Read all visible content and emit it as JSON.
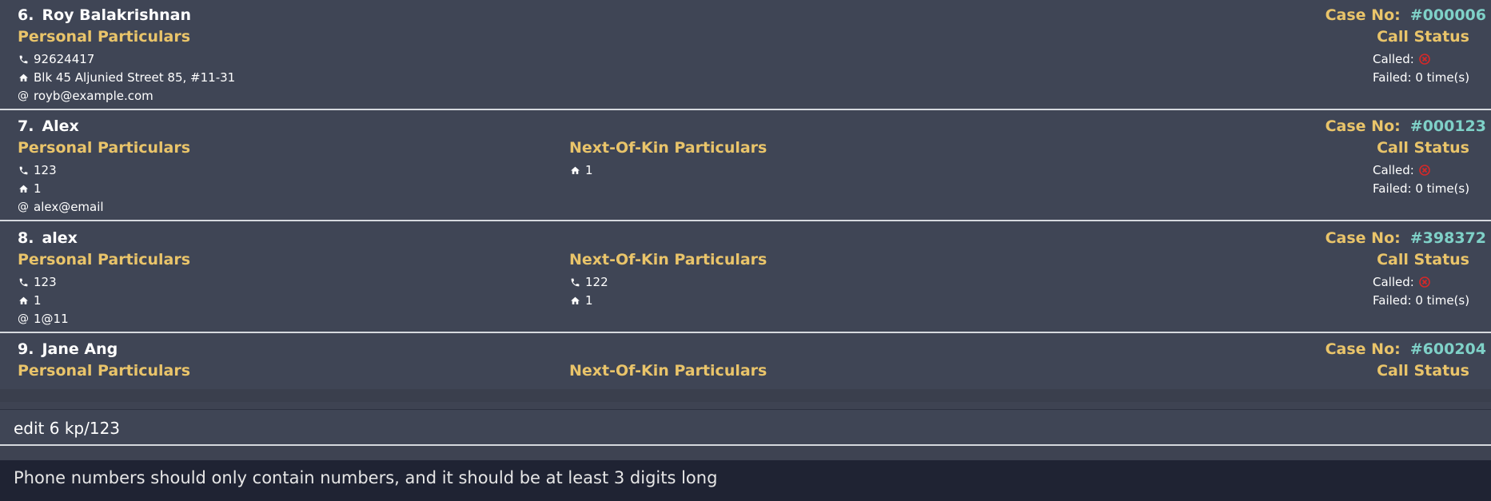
{
  "persons": [
    {
      "index": "6.",
      "name": "Roy Balakrishnan",
      "case_label": "Case No:",
      "case_no": "#000006",
      "personal_title": "Personal Particulars",
      "phone": "92624417",
      "address": "Blk 45 Aljunied Street 85, #11-31",
      "email": "royb@example.com",
      "nok_title": "",
      "nok_phone": "",
      "nok_address": "",
      "call_status_title": "Call Status",
      "called_label": "Called:",
      "failed_text": "Failed: 0 time(s)"
    },
    {
      "index": "7.",
      "name": "Alex",
      "case_label": "Case No:",
      "case_no": "#000123",
      "personal_title": "Personal Particulars",
      "phone": "123",
      "address": "1",
      "email": "alex@email",
      "nok_title": "Next-Of-Kin Particulars",
      "nok_phone": "",
      "nok_address": "1",
      "call_status_title": "Call Status",
      "called_label": "Called:",
      "failed_text": "Failed: 0 time(s)"
    },
    {
      "index": "8.",
      "name": "alex",
      "case_label": "Case No:",
      "case_no": "#398372",
      "personal_title": "Personal Particulars",
      "phone": "123",
      "address": "1",
      "email": "1@11",
      "nok_title": "Next-Of-Kin Particulars",
      "nok_phone": "122",
      "nok_address": "1",
      "call_status_title": "Call Status",
      "called_label": "Called:",
      "failed_text": "Failed: 0 time(s)"
    },
    {
      "index": "9.",
      "name": "Jane Ang",
      "case_label": "Case No:",
      "case_no": "#600204",
      "personal_title": "Personal Particulars",
      "phone": "",
      "address": "",
      "email": "",
      "nok_title": "Next-Of-Kin Particulars",
      "nok_phone": "",
      "nok_address": "",
      "call_status_title": "Call Status",
      "called_label": "",
      "failed_text": ""
    }
  ],
  "command": {
    "value": "edit 6 kp/123"
  },
  "result": {
    "message": "Phone numbers should only contain numbers, and it should be at least 3 digits long"
  },
  "colors": {
    "accent_title": "#e9c46a",
    "case_number": "#7fd1c8",
    "not_called": "#d62828",
    "background": "#3f4555",
    "result_background": "#1f2333"
  },
  "icons": {
    "phone": "phone-icon",
    "address": "home-icon",
    "email": "at-icon",
    "called_status": "x-circle-icon"
  }
}
